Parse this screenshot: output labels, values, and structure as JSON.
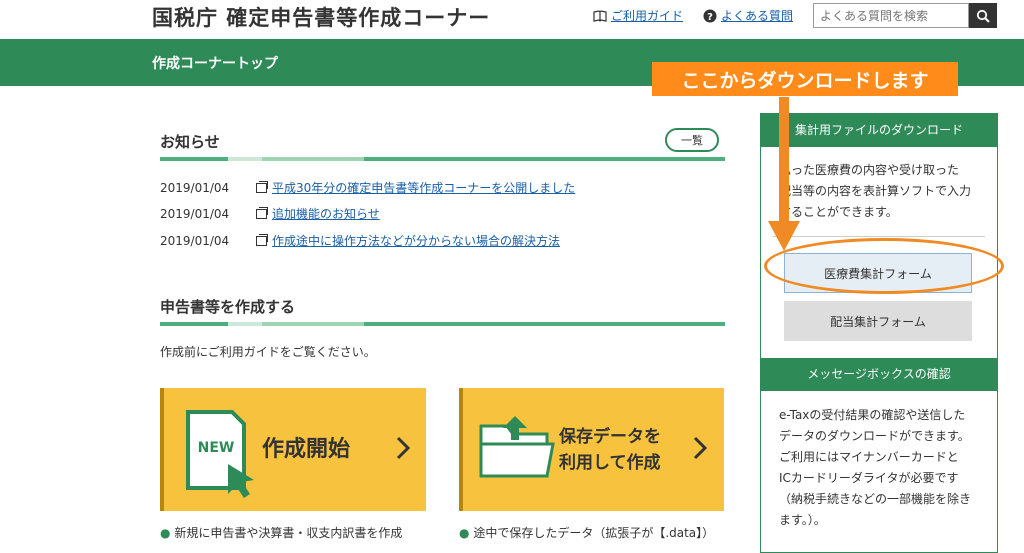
{
  "header": {
    "site_title": "国税庁 確定申告書等作成コーナー",
    "guide_link": "ご利用ガイド",
    "faq_link": "よくある質問",
    "search_placeholder": "よくある質問を検索"
  },
  "bar": {
    "title": "作成コーナートップ"
  },
  "news": {
    "title": "お知らせ",
    "list_button": "一覧",
    "items": [
      {
        "date": "2019/01/04",
        "text": "平成30年分の確定申告書等作成コーナーを公開しました"
      },
      {
        "date": "2019/01/04",
        "text": "追加機能のお知らせ"
      },
      {
        "date": "2019/01/04",
        "text": "作成途中に操作方法などが分からない場合の解決方法"
      }
    ]
  },
  "create": {
    "title": "申告書等を作成する",
    "note": "作成前にご利用ガイドをご覧ください。",
    "card1": {
      "badge": "NEW",
      "label": "作成開始",
      "bullet": "新規に申告書や決算書・収支内訳書を作成"
    },
    "card2": {
      "line1": "保存データを",
      "line2": "利用して作成",
      "bullet": "途中で保存したデータ（拡張子が【.data】）"
    }
  },
  "panel": {
    "download_title": "集計用ファイルのダウンロード",
    "download_desc": [
      "払った医療費の内容や受け取った",
      "配当等の内容を表計算ソフトで入力",
      "することができます。"
    ],
    "medical_button": "医療費集計フォーム",
    "dividend_button": "配当集計フォーム",
    "message_title": "メッセージボックスの確認",
    "message_desc": [
      "e-Taxの受付結果の確認や送信した",
      "データのダウンロードができます。",
      "ご利用にはマイナンバーカードと",
      "ICカードリーダライタが必要です",
      "（納税手続きなどの一部機能を除き",
      "ます。）。"
    ]
  },
  "annotation": {
    "callout": "ここからダウンロードします"
  },
  "colors": {
    "green": "#2e8b57",
    "yellow": "#f7c33e",
    "orange": "#ff8c1a",
    "link": "#1a5fa8"
  }
}
